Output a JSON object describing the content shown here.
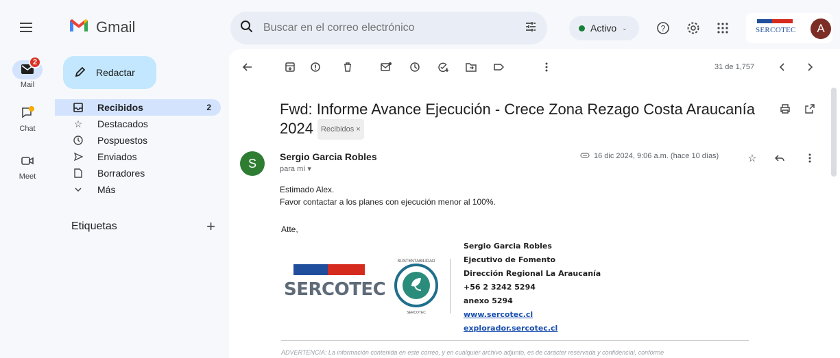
{
  "app": {
    "name": "Gmail",
    "brand_colors": {
      "accent": "#c2e7ff",
      "active": "#d3e3fd",
      "badge": "#d93025"
    }
  },
  "rail": [
    {
      "label": "Mail",
      "icon": "mail-icon",
      "badge": "2",
      "active": true
    },
    {
      "label": "Chat",
      "icon": "chat-icon",
      "active": false
    },
    {
      "label": "Meet",
      "icon": "video-icon",
      "active": false
    }
  ],
  "compose_label": "Redactar",
  "nav": [
    {
      "label": "Recibidos",
      "icon": "inbox-icon",
      "count": "2",
      "active": true
    },
    {
      "label": "Destacados",
      "icon": "star-icon"
    },
    {
      "label": "Pospuestos",
      "icon": "clock-icon"
    },
    {
      "label": "Enviados",
      "icon": "send-icon"
    },
    {
      "label": "Borradores",
      "icon": "draft-icon"
    },
    {
      "label": "Más",
      "icon": "chevron-down-icon"
    }
  ],
  "labels_title": "Etiquetas",
  "search": {
    "placeholder": "Buscar en el correo electrónico"
  },
  "status": {
    "label": "Activo"
  },
  "brand_logo_text": "SERCOTEC",
  "avatar_letter": "A",
  "pager": "31 de 1,757",
  "email": {
    "subject": "Fwd: Informe Avance Ejecución - Crece Zona Rezago Costa Araucanía 2024",
    "label_chip": "Recibidos ×",
    "sender_initial": "S",
    "sender": "Sergio Garcia Robles",
    "to": "para mí",
    "date": "16 dic 2024, 9:06 a.m. (hace 10 días)",
    "body_lines": [
      "Estimado Alex.",
      "Favor contactar a los planes con ejecución menor al 100%."
    ],
    "closing": "Atte,",
    "signature": {
      "name": "Sergio Garcia Robles",
      "role": "Ejecutivo de Fomento",
      "office": "Dirección Regional La Araucanía",
      "phone": "+56 2 3242 5294",
      "ext": "anexo 5294",
      "link1": "www.sercotec.cl",
      "link2": "explorador.sercotec.cl"
    },
    "sig_logo_text": "SERCOTEC",
    "seal_top": "SUSTENTABILIDAD",
    "seal_bottom": "SERCOTEC",
    "warning": "ADVERTENCIA: La información contenida en este correo, y en cualquier archivo adjunto, es de carácter reservada y confidencial, conforme"
  }
}
